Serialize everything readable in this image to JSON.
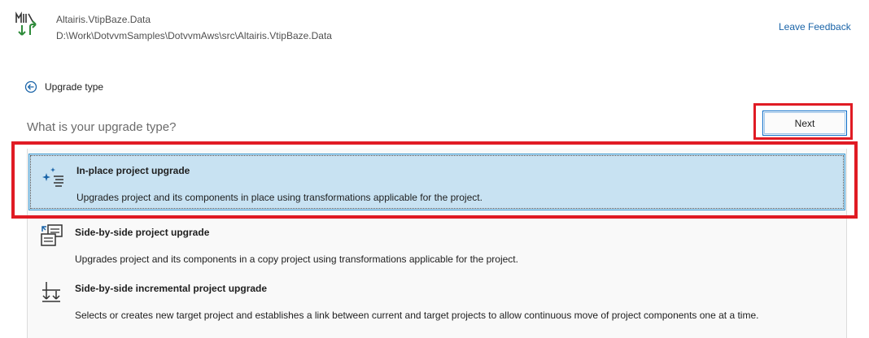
{
  "header": {
    "project_name": "Altairis.VtipBaze.Data",
    "project_path": "D:\\Work\\DotvvmSamples\\DotvvmAws\\src\\Altairis.VtipBaze.Data",
    "feedback_link": "Leave Feedback"
  },
  "nav": {
    "back_label": "Upgrade type"
  },
  "page": {
    "question": "What is your upgrade type?",
    "next_label": "Next"
  },
  "options": [
    {
      "title": "In-place project upgrade",
      "description": "Upgrades project and its components in place using transformations applicable for the project.",
      "icon": "sparkle-list-icon",
      "selected": true
    },
    {
      "title": "Side-by-side project upgrade",
      "description": "Upgrades project and its components in a copy project using transformations applicable for the project.",
      "icon": "copy-project-icon",
      "selected": false
    },
    {
      "title": "Side-by-side incremental project upgrade",
      "description": "Selects or creates new target project and establishes a link between current and target projects to allow continuous move of project components one at a time.",
      "icon": "incremental-arrows-icon",
      "selected": false
    }
  ],
  "colors": {
    "accent": "#0a6cc9",
    "selection_bg": "#c8e2f2",
    "highlight": "#e01b24",
    "link": "#1a64a8"
  }
}
